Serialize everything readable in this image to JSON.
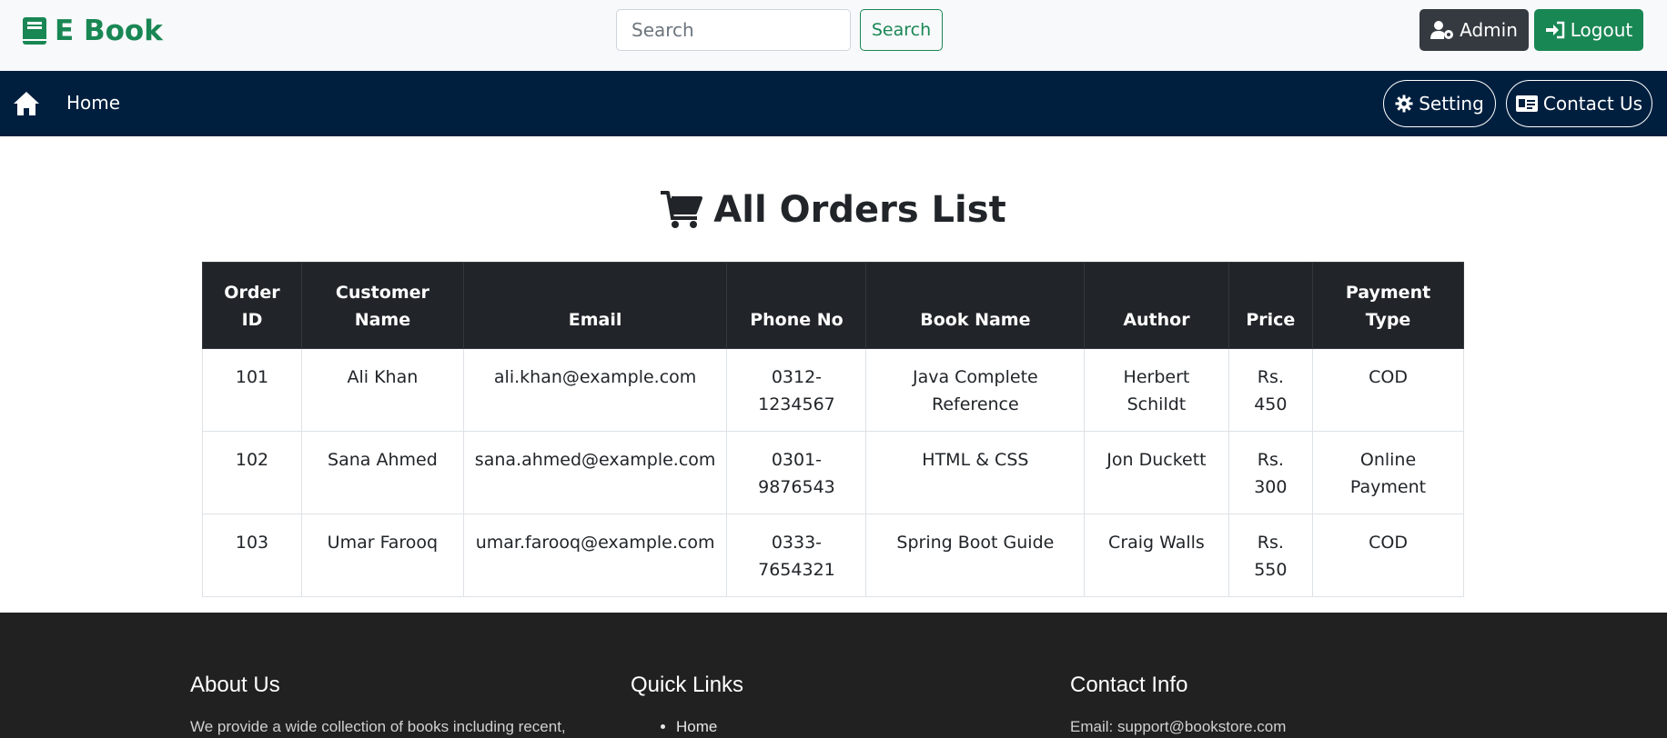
{
  "header": {
    "brand": "E Book",
    "search_placeholder": "Search",
    "search_button": "Search",
    "admin_button": "Admin",
    "logout_button": "Logout"
  },
  "navbar": {
    "home_label": "Home",
    "setting_button": "Setting",
    "contact_button": "Contact Us"
  },
  "main": {
    "title": "All Orders List",
    "columns": [
      "Order ID",
      "Customer Name",
      "Email",
      "Phone No",
      "Book Name",
      "Author",
      "Price",
      "Payment Type"
    ],
    "rows": [
      [
        "101",
        "Ali Khan",
        "ali.khan@example.com",
        "0312-1234567",
        "Java Complete Reference",
        "Herbert Schildt",
        "Rs. 450",
        "COD"
      ],
      [
        "102",
        "Sana Ahmed",
        "sana.ahmed@example.com",
        "0301-9876543",
        "HTML & CSS",
        "Jon Duckett",
        "Rs. 300",
        "Online Payment"
      ],
      [
        "103",
        "Umar Farooq",
        "umar.farooq@example.com",
        "0333-7654321",
        "Spring Boot Guide",
        "Craig Walls",
        "Rs. 550",
        "COD"
      ]
    ]
  },
  "footer": {
    "about_title": "About Us",
    "about_text": "We provide a wide collection of books including recent,",
    "links_title": "Quick Links",
    "links": [
      "Home"
    ],
    "contact_title": "Contact Info",
    "contact_email": "Email: support@bookstore.com"
  },
  "colors": {
    "brand": "#198754",
    "navbar": "#001f3f",
    "table_header": "#212529",
    "footer": "#212121"
  },
  "icons": [
    "book-icon",
    "user-gear-icon",
    "sign-in-icon",
    "home-icon",
    "gear-icon",
    "id-card-icon",
    "cart-icon"
  ]
}
